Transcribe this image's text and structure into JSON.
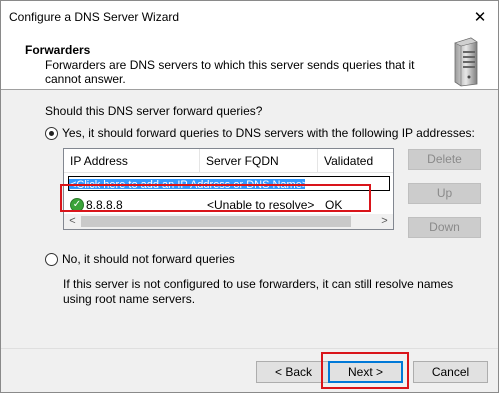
{
  "window": {
    "title": "Configure a DNS Server Wizard",
    "close_glyph": "✕"
  },
  "header": {
    "title": "Forwarders",
    "subtitle": "Forwarders are DNS servers to which this server sends queries that it cannot answer.",
    "icon": "server-icon"
  },
  "question": "Should this DNS server forward queries?",
  "options": {
    "yes_label": "Yes, it should forward queries to DNS servers with the following IP addresses:",
    "yes_selected": true,
    "no_label": "No, it should not forward queries",
    "no_selected": false,
    "no_description": "If this server is not configured to use forwarders, it can still resolve names using root name servers."
  },
  "forwarders_table": {
    "columns": [
      "IP Address",
      "Server FQDN",
      "Validated"
    ],
    "add_row_placeholder": "<Click here to add an IP Address or DNS Name>",
    "rows": [
      {
        "ip": "8.8.8.8",
        "fqdn": "<Unable to resolve>",
        "validated": "OK",
        "status_icon": "check-icon"
      }
    ]
  },
  "side_buttons": {
    "delete": "Delete",
    "up": "Up",
    "down": "Down"
  },
  "footer": {
    "back": "< Back",
    "next": "Next >",
    "cancel": "Cancel"
  },
  "colors": {
    "highlight": "#d9141a",
    "selection": "#3399ff",
    "ok_green": "#3aa339",
    "focus_blue": "#0078d7"
  }
}
